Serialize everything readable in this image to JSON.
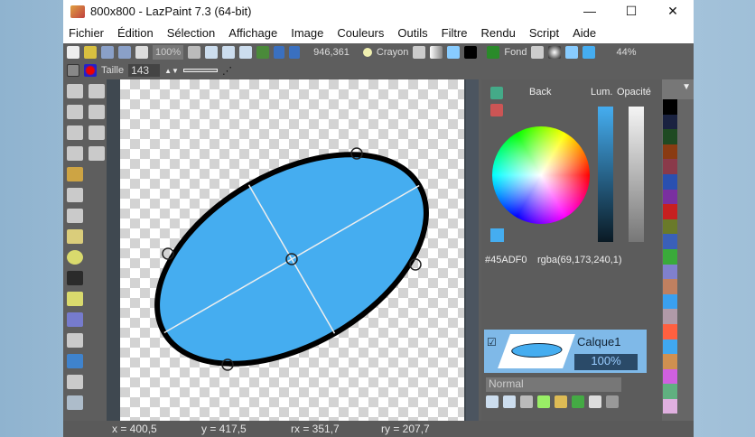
{
  "window": {
    "title": "800x800 - LazPaint 7.3 (64-bit)",
    "min": "—",
    "max": "☐",
    "close": "✕"
  },
  "menu": [
    "Fichier",
    "Édition",
    "Sélection",
    "Affichage",
    "Image",
    "Couleurs",
    "Outils",
    "Filtre",
    "Rendu",
    "Script",
    "Aide"
  ],
  "toolbar": {
    "zoom": "100%",
    "coords": "946,361",
    "pen_label": "Crayon",
    "back_label": "Fond",
    "opacity": "44%",
    "size_label": "Taille",
    "size_value": "143"
  },
  "color_panel": {
    "back_label": "Back",
    "lum_label": "Lum.",
    "opacity_label": "Opacité",
    "hex": "#45ADF0",
    "rgba": "rgba(69,173,240,1)",
    "current_color": "#45ADF0"
  },
  "layer": {
    "name": "Calque1",
    "opacity": "100%",
    "blend_mode": "Normal"
  },
  "palette": [
    "#000000",
    "#1a2240",
    "#1f4a22",
    "#8a3b12",
    "#8a3a4a",
    "#2a50b0",
    "#7a30a0",
    "#c82020",
    "#6a7a2a",
    "#3a60b8",
    "#3aaa3a",
    "#8080cc",
    "#c08060",
    "#3aa0f0",
    "#b09aa8",
    "#ff6040",
    "#40a8f0",
    "#d09050",
    "#d060e0",
    "#60b080",
    "#e0b0e0"
  ],
  "status": {
    "x": "x = 400,5",
    "y": "y = 417,5",
    "rx": "rx = 351,7",
    "ry": "ry = 207,7"
  }
}
